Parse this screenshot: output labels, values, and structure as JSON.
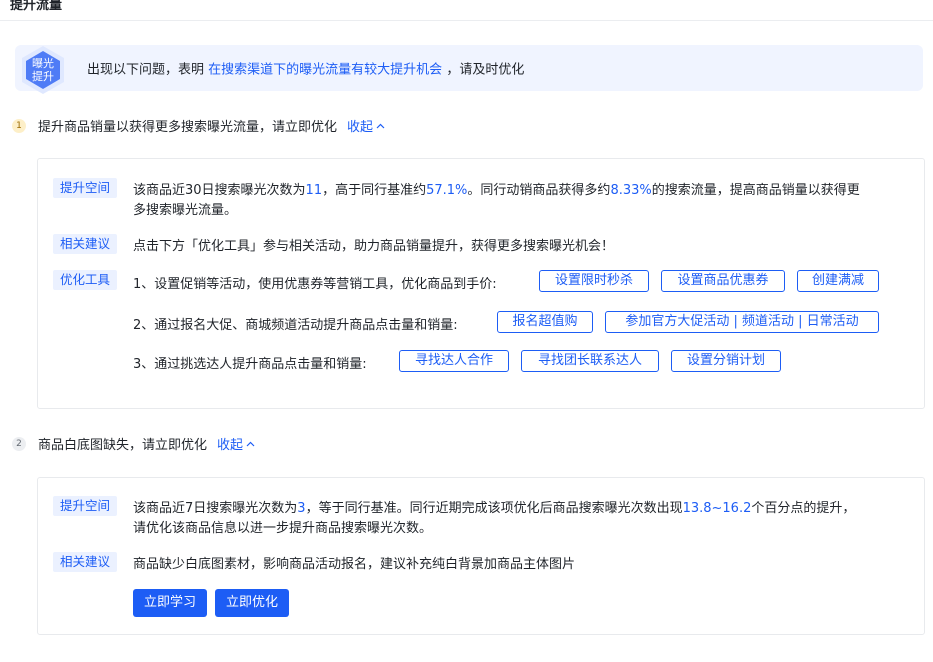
{
  "header": {
    "title_cut": "提升流量"
  },
  "banner": {
    "badge_line1": "曝光",
    "badge_line2": "提升",
    "text_before": "出现以下问题，表明",
    "text_highlight": "在搜索渠道下的曝光流量有较大提升机会",
    "text_after": "，请及时优化"
  },
  "sections": [
    {
      "index": "1",
      "title": "提升商品销量以获得更多搜索曝光流量，请立即优化",
      "toggle": "收起",
      "tags": {
        "space": "提升空间",
        "advice": "相关建议",
        "tools": "优化工具"
      },
      "space_text": {
        "p1": "该商品近30日搜索曝光次数为",
        "v1": "11",
        "p2": "，高于同行基准约",
        "v2": "57.1%",
        "p3": "。同行动销商品获得多约",
        "v3": "8.33%",
        "p4": "的搜索流量，提高商品销量以获得更",
        "line2": "多搜索曝光流量。"
      },
      "advice_text": "点击下方「优化工具」参与相关活动，助力商品销量提升，获得更多搜索曝光机会！",
      "tool_rows": [
        {
          "text": "1、设置促销等活动，使用优惠券等营销工具，优化商品到手价:",
          "buttons": [
            "设置限时秒杀",
            "设置商品优惠券",
            "创建满减"
          ]
        },
        {
          "text": "2、通过报名大促、商城频道活动提升商品点击量和销量:",
          "buttons": [
            "报名超值购",
            "参加官方大促活动 | 频道活动 | 日常活动"
          ]
        },
        {
          "text": "3、通过挑选达人提升商品点击量和销量:",
          "buttons": [
            "寻找达人合作",
            "寻找团长联系达人",
            "设置分销计划"
          ]
        }
      ]
    },
    {
      "index": "2",
      "title": "商品白底图缺失，请立即优化",
      "toggle": "收起",
      "tags": {
        "space": "提升空间",
        "advice": "相关建议"
      },
      "space_text": {
        "p1": "该商品近7日搜索曝光次数为",
        "v1": "3",
        "p2": "，等于同行基准。同行近期完成该项优化后商品搜索曝光次数出现",
        "v2": "13.8~16.2",
        "p3": "个百分点的提升，",
        "line2": "请优化该商品信息以进一步提升商品搜索曝光次数。"
      },
      "advice_text": "商品缺少白底图素材，影响商品活动报名，建议补充纯白背景加商品主体图片",
      "buttons": [
        "立即学习",
        "立即优化"
      ]
    }
  ],
  "colors": {
    "accent": "#1d5df5",
    "tag_bg": "#ebf1ff",
    "banner_bg": "#f0f4ff"
  }
}
